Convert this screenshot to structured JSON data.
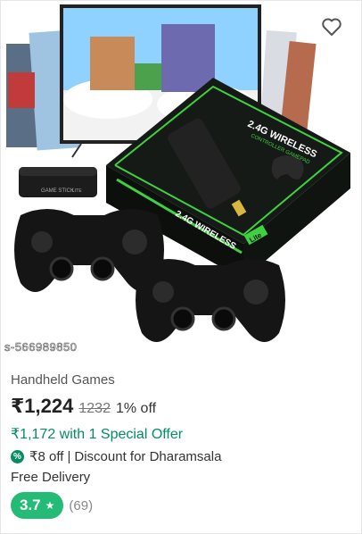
{
  "product": {
    "image_sku": "s-566989850",
    "box_text_top": "2.4G WIRELESS",
    "box_text_sub": "CONTROLLER GAMEPAD",
    "box_side_text": "2.4G WIRELESS",
    "box_badge": "Lite",
    "stick_text": "GAME STICK",
    "stick_sub": "LITE",
    "title": "Handheld Games",
    "price": "₹1,224",
    "mrp": "1232",
    "discount_percent": "1% off",
    "special_offer": "₹1,172 with 1 Special Offer",
    "discount_amount": "₹8 off",
    "discount_separator": "|",
    "discount_location": "Discount for Dharamsala",
    "delivery": "Free Delivery",
    "rating": "3.7",
    "rating_star": "★",
    "review_count": "(69)"
  },
  "icons": {
    "wishlist": "heart-outline-icon",
    "discount": "percent-badge-icon"
  },
  "colors": {
    "accent_green": "#038d63",
    "rating_green": "#23bb75",
    "box_green": "#3fd13f"
  }
}
